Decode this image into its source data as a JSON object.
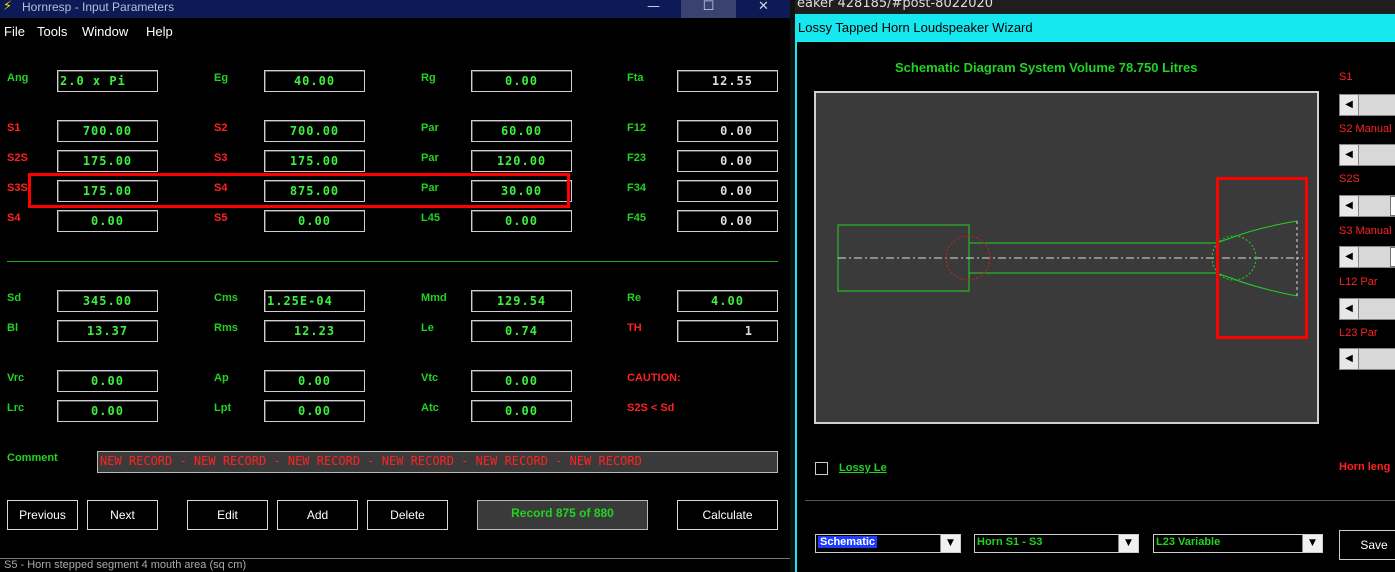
{
  "hornresp": {
    "title": "Hornresp - Input Parameters",
    "menu": [
      "File",
      "Tools",
      "Window",
      "Help"
    ],
    "window_controls": {
      "minimize": "—",
      "maximize": "☐",
      "close": "✕"
    },
    "labels": {
      "ang": "Ang",
      "eg": "Eg",
      "rg": "Rg",
      "fta": "Fta",
      "s1": "S1",
      "s2": "S2",
      "par1": "Par",
      "f12": "F12",
      "s2s": "S2S",
      "s3": "S3",
      "par2": "Par",
      "f23": "F23",
      "s3s": "S3S",
      "s4a": "S4",
      "par3": "Par",
      "f34": "F34",
      "s4": "S4",
      "s5": "S5",
      "l45": "L45",
      "f45": "F45",
      "sd": "Sd",
      "cms": "Cms",
      "mmd": "Mmd",
      "re": "Re",
      "bl": "Bl",
      "rms": "Rms",
      "le": "Le",
      "th": "TH",
      "vrc": "Vrc",
      "ap": "Ap",
      "vtc": "Vtc",
      "caution": "CAUTION:",
      "lrc": "Lrc",
      "lpt": "Lpt",
      "atc": "Atc",
      "caution_msg": "S2S < Sd",
      "comment": "Comment"
    },
    "values": {
      "ang": "2.0 x Pi",
      "eg": "40.00",
      "rg": "0.00",
      "fta": "12.55",
      "s1": "700.00",
      "s2": "700.00",
      "par1": "60.00",
      "f12": "0.00",
      "s2s": "175.00",
      "s3": "175.00",
      "par2": "120.00",
      "f23": "0.00",
      "s3s": "175.00",
      "s4a": "875.00",
      "par3": "30.00",
      "f34": "0.00",
      "s4": "0.00",
      "s5": "0.00",
      "l45": "0.00",
      "f45": "0.00",
      "sd": "345.00",
      "cms": "1.25E-04",
      "mmd": "129.54",
      "re": "4.00",
      "bl": "13.37",
      "rms": "12.23",
      "le": "0.74",
      "th": "1",
      "vrc": "0.00",
      "ap": "0.00",
      "vtc": "0.00",
      "lrc": "0.00",
      "lpt": "0.00",
      "atc": "0.00"
    },
    "comment_value": "NEW RECORD - NEW RECORD - NEW RECORD - NEW RECORD - NEW RECORD - NEW RECORD",
    "buttons": {
      "previous": "Previous",
      "next": "Next",
      "edit": "Edit",
      "add": "Add",
      "delete": "Delete",
      "calculate": "Calculate"
    },
    "record": "Record 875 of 880",
    "status": "S5 - Horn stepped segment 4 mouth area (sq cm)"
  },
  "browser_strip": "eaker 428185/#post-8022020",
  "wizard": {
    "title": "Lossy Tapped Horn Loudspeaker Wizard",
    "heading": "Schematic Diagram   System Volume 78.750 Litres",
    "sliders": [
      "S1",
      "S2 Manual",
      "S2S",
      "S3 Manual",
      "L12 Par",
      "L23 Par"
    ],
    "lossy_le": "Lossy Le",
    "horn_length": "Horn leng",
    "combos": {
      "view": "Schematic",
      "horn": "Horn S1 - S3",
      "l23": "L23 Variable"
    },
    "save": "Save",
    "colors": {
      "title_bar": "#16e8f0",
      "accent_green": "#22d322",
      "accent_red": "#ff2222"
    }
  }
}
